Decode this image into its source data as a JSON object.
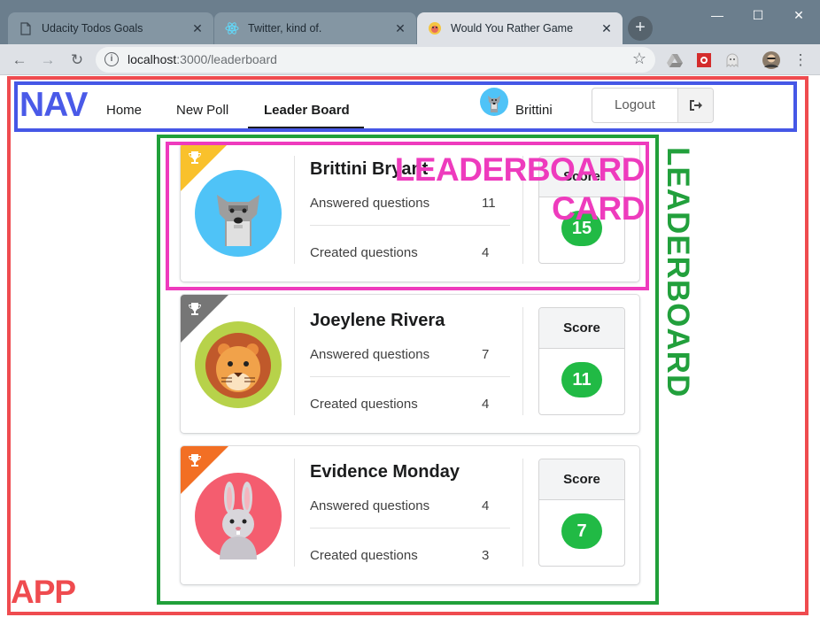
{
  "browser": {
    "tabs": [
      {
        "title": "Udacity Todos Goals",
        "icon": "document-icon",
        "active": false
      },
      {
        "title": "Twitter, kind of.",
        "icon": "react-icon",
        "active": false
      },
      {
        "title": "Would You Rather Game",
        "icon": "app-favicon",
        "active": true
      }
    ],
    "new_tab": "+",
    "window_controls": {
      "minimize": "—",
      "maximize": "☐",
      "close": "✕"
    },
    "url_host": "localhost",
    "url_rest": ":3000/leaderboard",
    "toolbar_icons": {
      "back": "←",
      "forward": "→",
      "reload": "↻",
      "bookmark": "☆",
      "menu": "⋮"
    }
  },
  "annotations": {
    "app": "APP",
    "nav": "NAV",
    "leaderboard": "LEADERBOARD",
    "leaderboard_card_line1": "LEADERBOARD",
    "leaderboard_card_line2": "CARD"
  },
  "nav": {
    "items": [
      {
        "label": "Home",
        "active": false
      },
      {
        "label": "New Poll",
        "active": false
      },
      {
        "label": "Leader Board",
        "active": true
      }
    ],
    "user_name": "Brittini",
    "logout_label": "Logout",
    "logout_icon": "sign-out-icon"
  },
  "leaderboard": {
    "cards": [
      {
        "name": "Brittini Bryant",
        "answered_label": "Answered questions",
        "answered": "11",
        "created_label": "Created questions",
        "created": "4",
        "score_label": "Score",
        "score": "15",
        "trophy_color": "#f9c12c",
        "avatar": "schnauzer-avatar"
      },
      {
        "name": "Joeylene Rivera",
        "answered_label": "Answered questions",
        "answered": "7",
        "created_label": "Created questions",
        "created": "4",
        "score_label": "Score",
        "score": "11",
        "trophy_color": "#767676",
        "avatar": "lion-avatar"
      },
      {
        "name": "Evidence Monday",
        "answered_label": "Answered questions",
        "answered": "4",
        "created_label": "Created questions",
        "created": "3",
        "score_label": "Score",
        "score": "7",
        "trophy_color": "#f26f24",
        "avatar": "rabbit-avatar"
      }
    ]
  },
  "colors": {
    "app_annotation": "#ef4b4f",
    "nav_annotation": "#4557e6",
    "leaderboard_annotation": "#21a03a",
    "card_annotation": "#ee3bbd",
    "score_badge": "#21ba45"
  }
}
